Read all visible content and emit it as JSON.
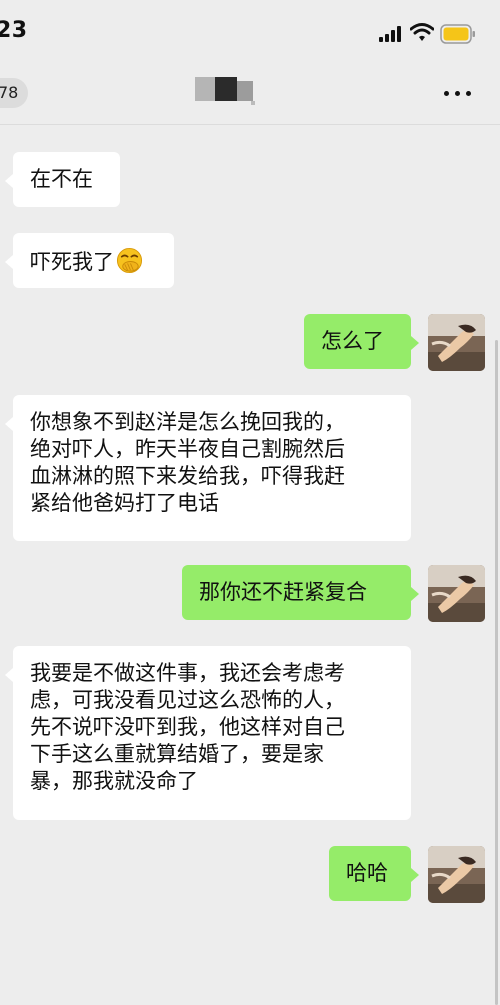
{
  "status_bar": {
    "time": "23"
  },
  "nav": {
    "back_badge": "78"
  },
  "messages": [
    {
      "side": "left",
      "text": "在不在"
    },
    {
      "side": "left",
      "text": "吓死我了",
      "emoji": "face-with-hand-over-mouth-emoji"
    },
    {
      "side": "right",
      "text": "怎么了"
    },
    {
      "side": "left",
      "lines": [
        "你想象不到赵洋是怎么挽回我的，",
        "绝对吓人，昨天半夜自己割腕然后",
        "血淋淋的照下来发给我，吓得我赶",
        "紧给他爸妈打了电话"
      ]
    },
    {
      "side": "right",
      "text": "那你还不赶紧复合"
    },
    {
      "side": "left",
      "lines": [
        "我要是不做这件事，我还会考虑考",
        "虑，可我没看见过这么恐怖的人，",
        "先不说吓没吓到我，他这样对自己",
        "下手这么重就算结婚了，要是家",
        "暴，那我就没命了"
      ]
    },
    {
      "side": "right",
      "text": "哈哈"
    }
  ],
  "colors": {
    "background": "#ededed",
    "sent_bubble": "#95ec69",
    "received_bubble": "#ffffff",
    "battery": "#f5c518"
  },
  "icons": [
    "signal-icon",
    "wifi-icon",
    "battery-icon",
    "more-options-icon",
    "avatar"
  ]
}
